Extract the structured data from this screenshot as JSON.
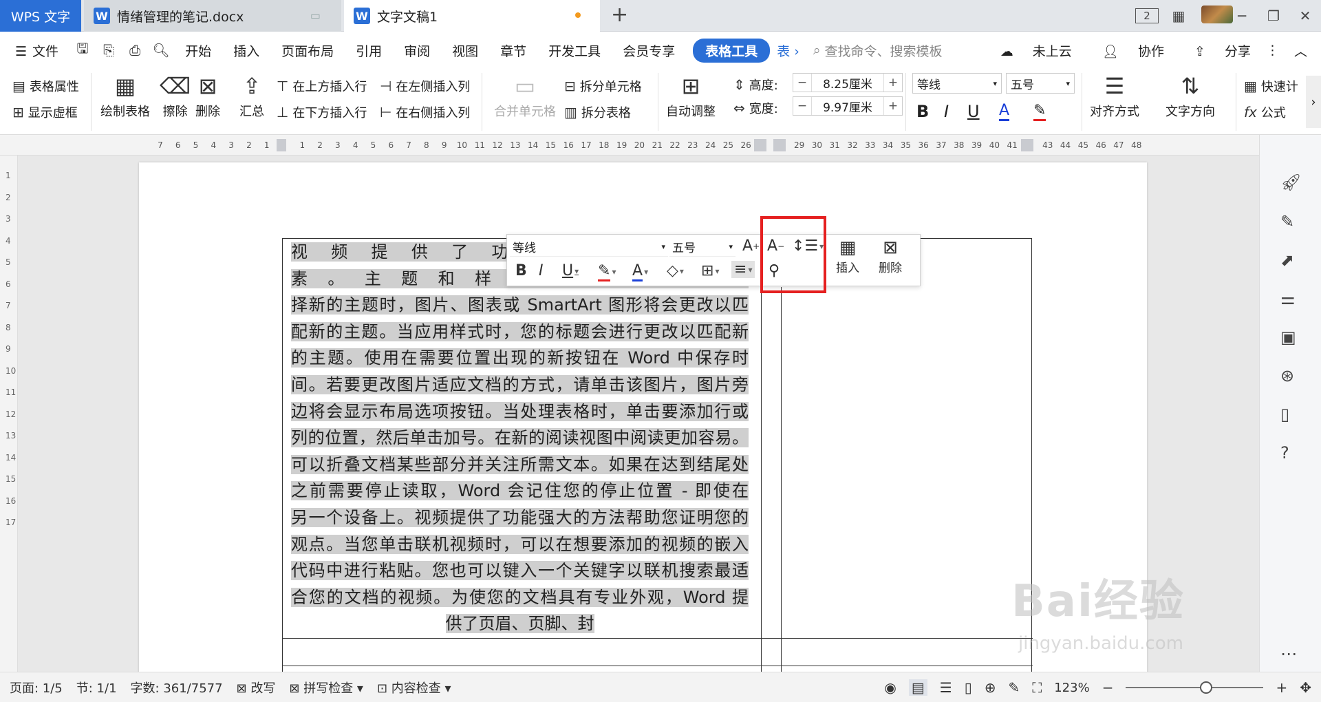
{
  "tabs": {
    "app": "WPS 文字",
    "doc1": "情绪管理的笔记.docx",
    "doc2": "文字文稿1",
    "new_tab": "+",
    "page_count_icon": "2"
  },
  "menu": {
    "file": "文件",
    "items": [
      "开始",
      "插入",
      "页面布局",
      "引用",
      "审阅",
      "视图",
      "章节",
      "开发工具",
      "会员专享"
    ],
    "active": "表格工具",
    "search": "查找命令、搜索模板",
    "cloud": "未上云",
    "collab": "协作",
    "share": "分享"
  },
  "ribbon": {
    "table_props": "表格属性",
    "show_grid": "显示虚框",
    "draw_table": "绘制表格",
    "erase": "擦除",
    "delete": "删除",
    "summary": "汇总",
    "insert_above": "在上方插入行",
    "insert_below": "在下方插入行",
    "insert_left": "在左侧插入列",
    "insert_right": "在右侧插入列",
    "merge_cells": "合并单元格",
    "split_cells": "拆分单元格",
    "split_table": "拆分表格",
    "auto_fit": "自动调整",
    "height_label": "高度:",
    "height_value": "8.25厘米",
    "width_label": "宽度:",
    "width_value": "9.97厘米",
    "font": "等线",
    "size": "五号",
    "align": "对齐方式",
    "text_dir": "文字方向",
    "quick_calc": "快速计",
    "formula": "公式"
  },
  "ruler_numbers": [
    "7",
    "6",
    "5",
    "4",
    "3",
    "2",
    "1",
    "",
    "1",
    "2",
    "3",
    "4",
    "5",
    "6",
    "7",
    "8",
    "9",
    "10",
    "11",
    "12",
    "13",
    "14",
    "15",
    "16",
    "17",
    "18",
    "19",
    "20",
    "21",
    "22",
    "23",
    "24",
    "25",
    "26",
    "",
    "",
    "29",
    "30",
    "31",
    "32",
    "33",
    "34",
    "35",
    "36",
    "37",
    "38",
    "39",
    "40",
    "41",
    "",
    "43",
    "44",
    "45",
    "46",
    "47",
    "48"
  ],
  "vruler_numbers": [
    "1",
    "2",
    "3",
    "4",
    "5",
    "6",
    "7",
    "8",
    "9",
    "10",
    "11",
    "12",
    "13",
    "14",
    "15",
    "16",
    "17"
  ],
  "document": {
    "lines": [
      "视频提供了功能强大的方法",
      "素。主题和样式也有助于文档",
      "择新的主题时，图片、图表或 SmartArt 图形将会更改以匹",
      "配新的主题。当应用样式时，您的标题会进行更改以匹配新",
      "的主题。使用在需要位置出现的新按钮在 Word 中保存时",
      "间。若要更改图片适应文档的方式，请单击该图片，图片旁",
      "边将会显示布局选项按钮。当处理表格时，单击要添加行或",
      "列的位置，然后单击加号。在新的阅读视图中阅读更加容易。",
      "可以折叠文档某些部分并关注所需文本。如果在达到结尾处",
      "之前需要停止读取，Word 会记住您的停止位置 - 即使在",
      "另一个设备上。视频提供了功能强大的方法帮助您证明您的",
      "观点。当您单击联机视频时，可以在想要添加的视频的嵌入",
      "代码中进行粘贴。您也可以键入一个关键字以联机搜索最适",
      "合您的文档的视频。为使您的文档具有专业外观，Word 提",
      "供了页眉、页脚、封"
    ]
  },
  "mini_toolbar": {
    "font": "等线",
    "size": "五号",
    "insert": "插入",
    "delete": "删除"
  },
  "status": {
    "page": "页面: 1/5",
    "section": "节: 1/1",
    "words": "字数: 361/7577",
    "revise": "改写",
    "spell": "拼写检查",
    "content_check": "内容检查",
    "zoom": "123%"
  },
  "watermark": {
    "brand": "Bai经验",
    "url": "jingyan.baidu.com"
  },
  "colors": {
    "accent": "#2b6fd6",
    "highlight_box": "#e52020",
    "selection": "#cfcfcf"
  }
}
